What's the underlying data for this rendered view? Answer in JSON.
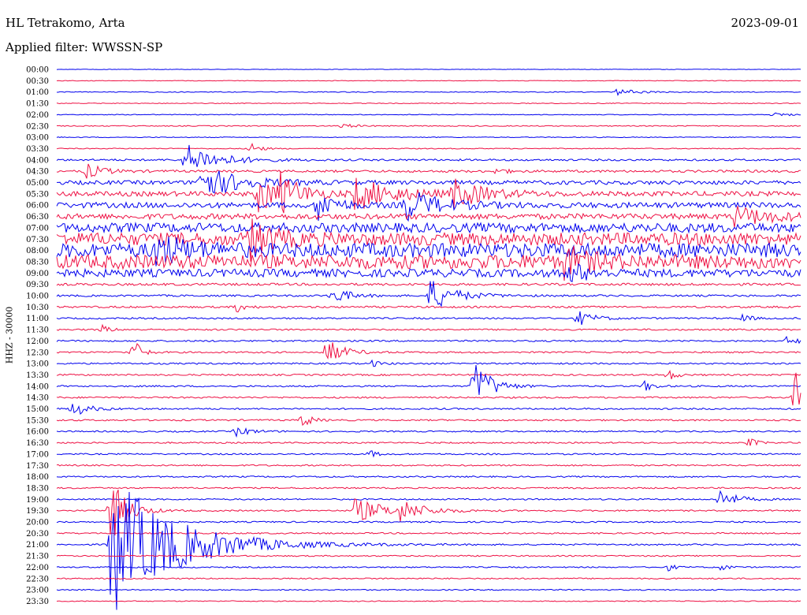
{
  "header": {
    "station": "HL Tetrakomo, Arta",
    "date": "2023-09-01",
    "filter": "Applied filter: WWSSN-SP",
    "channel": "HHZ - 30000"
  },
  "colors": {
    "a": "#0000ee",
    "b": "#ee1144"
  },
  "chart_data": {
    "type": "line",
    "title": "HL Tetrakomo, Arta",
    "subtitle": "Applied filter: WWSSN-SP",
    "ylabel": "HHZ - 30000",
    "xlabel": "",
    "rows": [
      "00:00",
      "00:30",
      "01:00",
      "01:30",
      "02:00",
      "02:30",
      "03:00",
      "03:30",
      "04:00",
      "04:30",
      "05:00",
      "05:30",
      "06:00",
      "06:30",
      "07:00",
      "07:30",
      "08:00",
      "08:30",
      "09:00",
      "09:30",
      "10:00",
      "10:30",
      "11:00",
      "11:30",
      "12:00",
      "12:30",
      "13:00",
      "13:30",
      "14:00",
      "14:30",
      "15:00",
      "15:30",
      "16:00",
      "16:30",
      "17:00",
      "17:30",
      "18:00",
      "18:30",
      "19:00",
      "19:30",
      "20:00",
      "20:30",
      "21:00",
      "21:30",
      "22:00",
      "22:30",
      "23:00",
      "23:30"
    ],
    "series_colors": [
      "#0000ee",
      "#ee1144"
    ],
    "noise_level": [
      0.3,
      0.4,
      0.5,
      0.5,
      0.5,
      0.6,
      0.5,
      0.6,
      1.2,
      1.5,
      2.5,
      3.0,
      3.5,
      3.5,
      6,
      8,
      9,
      9,
      5,
      1.5,
      1.2,
      1.2,
      1.0,
      1.0,
      1.0,
      1.0,
      1.0,
      1.0,
      1.0,
      1.0,
      1.0,
      1.0,
      0.9,
      0.9,
      0.9,
      0.9,
      0.9,
      0.9,
      0.9,
      0.9,
      0.9,
      0.9,
      0.9,
      0.8,
      0.8,
      0.8,
      0.7,
      0.6
    ],
    "events": [
      {
        "row": 2,
        "x": 0.75,
        "amp": 4,
        "dur": 0.03
      },
      {
        "row": 4,
        "x": 0.96,
        "amp": 3,
        "dur": 0.02
      },
      {
        "row": 5,
        "x": 0.38,
        "amp": 3,
        "dur": 0.02
      },
      {
        "row": 7,
        "x": 0.26,
        "amp": 10,
        "dur": 0.01
      },
      {
        "row": 8,
        "x": 0.17,
        "amp": 22,
        "dur": 0.04
      },
      {
        "row": 9,
        "x": 0.04,
        "amp": 10,
        "dur": 0.02
      },
      {
        "row": 9,
        "x": 0.59,
        "amp": 6,
        "dur": 0.01
      },
      {
        "row": 10,
        "x": 0.19,
        "amp": 22,
        "dur": 0.05
      },
      {
        "row": 11,
        "x": 0.27,
        "amp": 28,
        "dur": 0.02
      },
      {
        "row": 11,
        "x": 0.3,
        "amp": 22,
        "dur": 0.03
      },
      {
        "row": 11,
        "x": 0.4,
        "amp": 20,
        "dur": 0.05
      },
      {
        "row": 11,
        "x": 0.53,
        "amp": 18,
        "dur": 0.04
      },
      {
        "row": 12,
        "x": 0.35,
        "amp": 22,
        "dur": 0.02
      },
      {
        "row": 12,
        "x": 0.47,
        "amp": 20,
        "dur": 0.04
      },
      {
        "row": 13,
        "x": 0.91,
        "amp": 12,
        "dur": 0.05
      },
      {
        "row": 15,
        "x": 0.26,
        "amp": 22,
        "dur": 0.03
      },
      {
        "row": 16,
        "x": 0.13,
        "amp": 18,
        "dur": 0.04
      },
      {
        "row": 17,
        "x": 0.68,
        "amp": 18,
        "dur": 0.03
      },
      {
        "row": 18,
        "x": 0.69,
        "amp": 14,
        "dur": 0.02
      },
      {
        "row": 20,
        "x": 0.37,
        "amp": 12,
        "dur": 0.02
      },
      {
        "row": 20,
        "x": 0.5,
        "amp": 22,
        "dur": 0.03
      },
      {
        "row": 21,
        "x": 0.24,
        "amp": 8,
        "dur": 0.01
      },
      {
        "row": 22,
        "x": 0.7,
        "amp": 10,
        "dur": 0.02
      },
      {
        "row": 22,
        "x": 0.92,
        "amp": 7,
        "dur": 0.01
      },
      {
        "row": 23,
        "x": 0.06,
        "amp": 6,
        "dur": 0.01
      },
      {
        "row": 24,
        "x": 0.98,
        "amp": 5,
        "dur": 0.02
      },
      {
        "row": 25,
        "x": 0.1,
        "amp": 24,
        "dur": 0.01
      },
      {
        "row": 25,
        "x": 0.36,
        "amp": 20,
        "dur": 0.02
      },
      {
        "row": 26,
        "x": 0.42,
        "amp": 6,
        "dur": 0.01
      },
      {
        "row": 27,
        "x": 0.82,
        "amp": 9,
        "dur": 0.01
      },
      {
        "row": 28,
        "x": 0.56,
        "amp": 38,
        "dur": 0.02
      },
      {
        "row": 28,
        "x": 0.79,
        "amp": 8,
        "dur": 0.01
      },
      {
        "row": 29,
        "x": 0.99,
        "amp": 55,
        "dur": 0.02
      },
      {
        "row": 30,
        "x": 0.02,
        "amp": 10,
        "dur": 0.02
      },
      {
        "row": 31,
        "x": 0.33,
        "amp": 12,
        "dur": 0.01
      },
      {
        "row": 32,
        "x": 0.24,
        "amp": 6,
        "dur": 0.02
      },
      {
        "row": 33,
        "x": 0.93,
        "amp": 7,
        "dur": 0.01
      },
      {
        "row": 34,
        "x": 0.42,
        "amp": 5,
        "dur": 0.01
      },
      {
        "row": 38,
        "x": 0.89,
        "amp": 14,
        "dur": 0.02
      },
      {
        "row": 39,
        "x": 0.4,
        "amp": 16,
        "dur": 0.04
      },
      {
        "row": 39,
        "x": 0.46,
        "amp": 12,
        "dur": 0.03
      },
      {
        "row": 39,
        "x": 0.07,
        "amp": 48,
        "dur": 0.02
      },
      {
        "row": 42,
        "x": 0.07,
        "amp": 95,
        "dur": 0.08
      },
      {
        "row": 44,
        "x": 0.89,
        "amp": 6,
        "dur": 0.01
      },
      {
        "row": 44,
        "x": 0.82,
        "amp": 5,
        "dur": 0.01
      }
    ]
  }
}
